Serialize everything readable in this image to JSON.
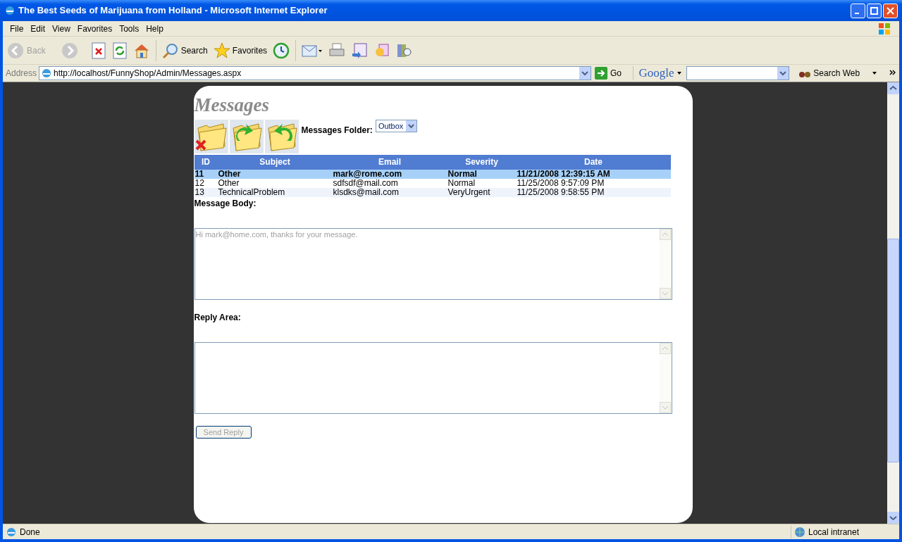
{
  "window": {
    "title": "The Best Seeds of Marijuana from Holland - Microsoft Internet Explorer"
  },
  "menu": [
    "File",
    "Edit",
    "View",
    "Favorites",
    "Tools",
    "Help"
  ],
  "toolbar": {
    "back": {
      "label": "Back",
      "disabled": true
    },
    "search": "Search",
    "favorites": "Favorites"
  },
  "address_bar": {
    "label": "Address",
    "url": "http://localhost/FunnyShop/Admin/Messages.aspx",
    "go": "Go"
  },
  "google_bar": {
    "logo": "Google",
    "search_button": "Search Web"
  },
  "page": {
    "heading": "Messages",
    "folder_label": "Messages Folder:",
    "folder_value": "Outbox",
    "table": {
      "columns": [
        "ID",
        "Subject",
        "Email",
        "Severity",
        "Date"
      ],
      "rows": [
        {
          "cells": [
            "11",
            "Other",
            "mark@rome.com",
            "Normal",
            "11/21/2008 12:39:15 AM"
          ],
          "selected": true
        },
        {
          "cells": [
            "12",
            "Other",
            "sdfsdf@mail.com",
            "Normal",
            "11/25/2008 9:57:09 PM"
          ],
          "selected": false
        },
        {
          "cells": [
            "13",
            "TechnicalProblem",
            "klsdks@mail.com",
            "VeryUrgent",
            "11/25/2008 9:58:55 PM"
          ],
          "selected": false
        }
      ]
    },
    "body_label": "Message Body:",
    "body_text": "Hi mark@home.com, thanks for your message.",
    "body_disabled": true,
    "reply_label": "Reply Area:",
    "send_button": {
      "label": "Send Reply",
      "disabled": true
    }
  },
  "status_bar": {
    "text": "Done",
    "zone": "Local intranet"
  }
}
